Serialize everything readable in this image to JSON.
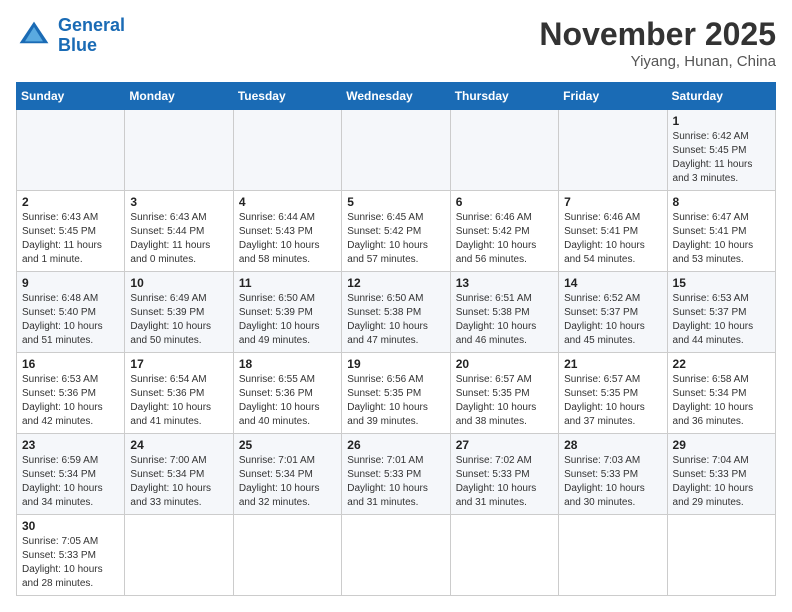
{
  "header": {
    "logo_line1": "General",
    "logo_line2": "Blue",
    "month": "November 2025",
    "location": "Yiyang, Hunan, China"
  },
  "weekdays": [
    "Sunday",
    "Monday",
    "Tuesday",
    "Wednesday",
    "Thursday",
    "Friday",
    "Saturday"
  ],
  "weeks": [
    [
      {
        "day": "",
        "info": ""
      },
      {
        "day": "",
        "info": ""
      },
      {
        "day": "",
        "info": ""
      },
      {
        "day": "",
        "info": ""
      },
      {
        "day": "",
        "info": ""
      },
      {
        "day": "",
        "info": ""
      },
      {
        "day": "1",
        "info": "Sunrise: 6:42 AM\nSunset: 5:45 PM\nDaylight: 11 hours\nand 3 minutes."
      }
    ],
    [
      {
        "day": "2",
        "info": "Sunrise: 6:43 AM\nSunset: 5:45 PM\nDaylight: 11 hours\nand 1 minute."
      },
      {
        "day": "3",
        "info": "Sunrise: 6:43 AM\nSunset: 5:44 PM\nDaylight: 11 hours\nand 0 minutes."
      },
      {
        "day": "4",
        "info": "Sunrise: 6:44 AM\nSunset: 5:43 PM\nDaylight: 10 hours\nand 58 minutes."
      },
      {
        "day": "5",
        "info": "Sunrise: 6:45 AM\nSunset: 5:42 PM\nDaylight: 10 hours\nand 57 minutes."
      },
      {
        "day": "6",
        "info": "Sunrise: 6:46 AM\nSunset: 5:42 PM\nDaylight: 10 hours\nand 56 minutes."
      },
      {
        "day": "7",
        "info": "Sunrise: 6:46 AM\nSunset: 5:41 PM\nDaylight: 10 hours\nand 54 minutes."
      },
      {
        "day": "8",
        "info": "Sunrise: 6:47 AM\nSunset: 5:41 PM\nDaylight: 10 hours\nand 53 minutes."
      }
    ],
    [
      {
        "day": "9",
        "info": "Sunrise: 6:48 AM\nSunset: 5:40 PM\nDaylight: 10 hours\nand 51 minutes."
      },
      {
        "day": "10",
        "info": "Sunrise: 6:49 AM\nSunset: 5:39 PM\nDaylight: 10 hours\nand 50 minutes."
      },
      {
        "day": "11",
        "info": "Sunrise: 6:50 AM\nSunset: 5:39 PM\nDaylight: 10 hours\nand 49 minutes."
      },
      {
        "day": "12",
        "info": "Sunrise: 6:50 AM\nSunset: 5:38 PM\nDaylight: 10 hours\nand 47 minutes."
      },
      {
        "day": "13",
        "info": "Sunrise: 6:51 AM\nSunset: 5:38 PM\nDaylight: 10 hours\nand 46 minutes."
      },
      {
        "day": "14",
        "info": "Sunrise: 6:52 AM\nSunset: 5:37 PM\nDaylight: 10 hours\nand 45 minutes."
      },
      {
        "day": "15",
        "info": "Sunrise: 6:53 AM\nSunset: 5:37 PM\nDaylight: 10 hours\nand 44 minutes."
      }
    ],
    [
      {
        "day": "16",
        "info": "Sunrise: 6:53 AM\nSunset: 5:36 PM\nDaylight: 10 hours\nand 42 minutes."
      },
      {
        "day": "17",
        "info": "Sunrise: 6:54 AM\nSunset: 5:36 PM\nDaylight: 10 hours\nand 41 minutes."
      },
      {
        "day": "18",
        "info": "Sunrise: 6:55 AM\nSunset: 5:36 PM\nDaylight: 10 hours\nand 40 minutes."
      },
      {
        "day": "19",
        "info": "Sunrise: 6:56 AM\nSunset: 5:35 PM\nDaylight: 10 hours\nand 39 minutes."
      },
      {
        "day": "20",
        "info": "Sunrise: 6:57 AM\nSunset: 5:35 PM\nDaylight: 10 hours\nand 38 minutes."
      },
      {
        "day": "21",
        "info": "Sunrise: 6:57 AM\nSunset: 5:35 PM\nDaylight: 10 hours\nand 37 minutes."
      },
      {
        "day": "22",
        "info": "Sunrise: 6:58 AM\nSunset: 5:34 PM\nDaylight: 10 hours\nand 36 minutes."
      }
    ],
    [
      {
        "day": "23",
        "info": "Sunrise: 6:59 AM\nSunset: 5:34 PM\nDaylight: 10 hours\nand 34 minutes."
      },
      {
        "day": "24",
        "info": "Sunrise: 7:00 AM\nSunset: 5:34 PM\nDaylight: 10 hours\nand 33 minutes."
      },
      {
        "day": "25",
        "info": "Sunrise: 7:01 AM\nSunset: 5:34 PM\nDaylight: 10 hours\nand 32 minutes."
      },
      {
        "day": "26",
        "info": "Sunrise: 7:01 AM\nSunset: 5:33 PM\nDaylight: 10 hours\nand 31 minutes."
      },
      {
        "day": "27",
        "info": "Sunrise: 7:02 AM\nSunset: 5:33 PM\nDaylight: 10 hours\nand 31 minutes."
      },
      {
        "day": "28",
        "info": "Sunrise: 7:03 AM\nSunset: 5:33 PM\nDaylight: 10 hours\nand 30 minutes."
      },
      {
        "day": "29",
        "info": "Sunrise: 7:04 AM\nSunset: 5:33 PM\nDaylight: 10 hours\nand 29 minutes."
      }
    ],
    [
      {
        "day": "30",
        "info": "Sunrise: 7:05 AM\nSunset: 5:33 PM\nDaylight: 10 hours\nand 28 minutes."
      },
      {
        "day": "",
        "info": ""
      },
      {
        "day": "",
        "info": ""
      },
      {
        "day": "",
        "info": ""
      },
      {
        "day": "",
        "info": ""
      },
      {
        "day": "",
        "info": ""
      },
      {
        "day": "",
        "info": ""
      }
    ]
  ]
}
